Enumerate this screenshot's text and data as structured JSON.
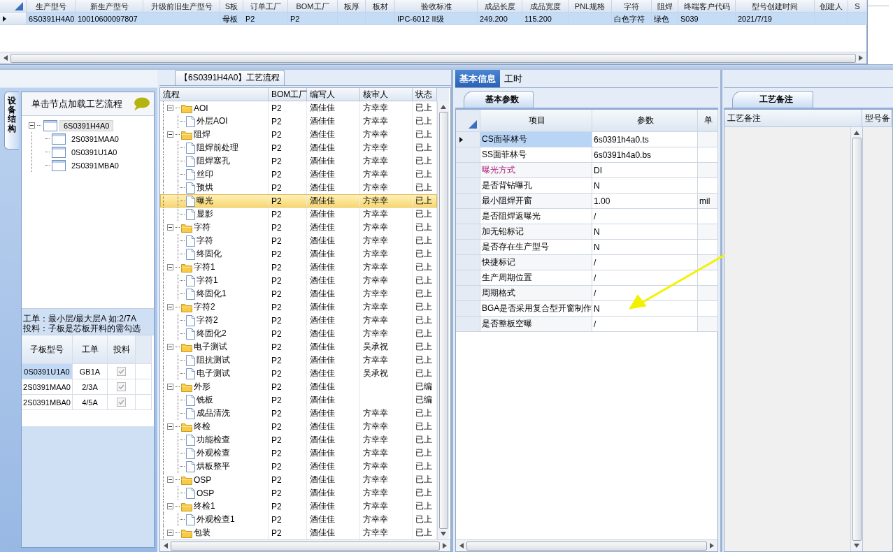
{
  "production_grid": {
    "columns": [
      "生产型号",
      "新生产型号",
      "升级前旧生产型号",
      "S板",
      "订单工厂",
      "BOM工厂",
      "板厚",
      "板材",
      "验收标准",
      "成品长度",
      "成品宽度",
      "PNL规格",
      "字符",
      "阻焊",
      "终端客户代码",
      "型号创建时间",
      "创建人",
      "S"
    ],
    "rows": [
      {
        "selected": true,
        "cells": [
          "6S0391H4A0",
          "10010600097807",
          null,
          "母板",
          "P2",
          "P2",
          null,
          null,
          "IPC-6012 II级",
          "249.200",
          "115.200",
          null,
          "白色字符",
          "绿色",
          "S039",
          "2021/7/19",
          null,
          null
        ]
      }
    ]
  },
  "equipment_panel": {
    "side_tab": "设备结构",
    "hint": "单击节点加载工艺流程",
    "tree": [
      {
        "label": "6S0391H4A0",
        "selected": true,
        "expanded": true,
        "children": [
          {
            "label": "2S0391MAA0",
            "selected": false
          },
          {
            "label": "0S0391U1A0",
            "selected": false
          },
          {
            "label": "2S0391MBA0",
            "selected": false
          }
        ]
      }
    ],
    "notes": [
      "工单：最小层/最大层A 如:2/7A",
      "投料：子板是芯板开料的需勾选"
    ],
    "sub_grid": {
      "columns": [
        "子板型号",
        "工单",
        "投料"
      ],
      "rows": [
        {
          "board": "0S0391U1A0",
          "order": "GB1A",
          "feed_checked": true,
          "selected": true
        },
        {
          "board": "2S0391MAA0",
          "order": "2/3A",
          "feed_checked": true,
          "selected": false
        },
        {
          "board": "2S0391MBA0",
          "order": "4/5A",
          "feed_checked": true,
          "selected": false
        }
      ]
    }
  },
  "process_flow": {
    "title": "【6S0391H4A0】工艺流程",
    "columns": [
      "流程",
      "BOM工厂",
      "编写人",
      "核审人",
      "状态"
    ],
    "steps": [
      {
        "label": "AOI",
        "bom": "P2",
        "author": "酒佳佳",
        "reviewer": "方幸幸",
        "status": "已上",
        "selected": false,
        "expanded": true,
        "children": [
          {
            "label": "外层AOI",
            "bom": "P2",
            "author": "酒佳佳",
            "reviewer": "方幸幸",
            "status": "已上",
            "selected": false
          }
        ]
      },
      {
        "label": "阻焊",
        "bom": "P2",
        "author": "酒佳佳",
        "reviewer": "方幸幸",
        "status": "已上",
        "selected": false,
        "expanded": true,
        "children": [
          {
            "label": "阻焊前处理",
            "bom": "P2",
            "author": "酒佳佳",
            "reviewer": "方幸幸",
            "status": "已上",
            "selected": false
          },
          {
            "label": "阻焊塞孔",
            "bom": "P2",
            "author": "酒佳佳",
            "reviewer": "方幸幸",
            "status": "已上",
            "selected": false
          },
          {
            "label": "丝印",
            "bom": "P2",
            "author": "酒佳佳",
            "reviewer": "方幸幸",
            "status": "已上",
            "selected": false
          },
          {
            "label": "预烘",
            "bom": "P2",
            "author": "酒佳佳",
            "reviewer": "方幸幸",
            "status": "已上",
            "selected": false
          },
          {
            "label": "曝光",
            "bom": "P2",
            "author": "酒佳佳",
            "reviewer": "方幸幸",
            "status": "已上",
            "selected": true
          },
          {
            "label": "显影",
            "bom": "P2",
            "author": "酒佳佳",
            "reviewer": "方幸幸",
            "status": "已上",
            "selected": false
          }
        ]
      },
      {
        "label": "字符",
        "bom": "P2",
        "author": "酒佳佳",
        "reviewer": "方幸幸",
        "status": "已上",
        "selected": false,
        "expanded": true,
        "children": [
          {
            "label": "字符",
            "bom": "P2",
            "author": "酒佳佳",
            "reviewer": "方幸幸",
            "status": "已上",
            "selected": false
          },
          {
            "label": "终固化",
            "bom": "P2",
            "author": "酒佳佳",
            "reviewer": "方幸幸",
            "status": "已上",
            "selected": false
          }
        ]
      },
      {
        "label": "字符1",
        "bom": "P2",
        "author": "酒佳佳",
        "reviewer": "方幸幸",
        "status": "已上",
        "selected": false,
        "expanded": true,
        "children": [
          {
            "label": "字符1",
            "bom": "P2",
            "author": "酒佳佳",
            "reviewer": "方幸幸",
            "status": "已上",
            "selected": false
          },
          {
            "label": "终固化1",
            "bom": "P2",
            "author": "酒佳佳",
            "reviewer": "方幸幸",
            "status": "已上",
            "selected": false
          }
        ]
      },
      {
        "label": "字符2",
        "bom": "P2",
        "author": "酒佳佳",
        "reviewer": "方幸幸",
        "status": "已上",
        "selected": false,
        "expanded": true,
        "children": [
          {
            "label": "字符2",
            "bom": "P2",
            "author": "酒佳佳",
            "reviewer": "方幸幸",
            "status": "已上",
            "selected": false
          },
          {
            "label": "终固化2",
            "bom": "P2",
            "author": "酒佳佳",
            "reviewer": "方幸幸",
            "status": "已上",
            "selected": false
          }
        ]
      },
      {
        "label": "电子测试",
        "bom": "P2",
        "author": "酒佳佳",
        "reviewer": "吴承祝",
        "status": "已上",
        "selected": false,
        "expanded": true,
        "children": [
          {
            "label": "阻抗测试",
            "bom": "P2",
            "author": "酒佳佳",
            "reviewer": "方幸幸",
            "status": "已上",
            "selected": false
          },
          {
            "label": "电子测试",
            "bom": "P2",
            "author": "酒佳佳",
            "reviewer": "吴承祝",
            "status": "已上",
            "selected": false
          }
        ]
      },
      {
        "label": "外形",
        "bom": "P2",
        "author": "酒佳佳",
        "status": "已编",
        "selected": false,
        "expanded": true,
        "children": [
          {
            "label": "铣板",
            "bom": "P2",
            "author": "酒佳佳",
            "status": "已编",
            "selected": false
          },
          {
            "label": "成品清洗",
            "bom": "P2",
            "author": "酒佳佳",
            "reviewer": "方幸幸",
            "status": "已上",
            "selected": false
          }
        ]
      },
      {
        "label": "终检",
        "bom": "P2",
        "author": "酒佳佳",
        "reviewer": "方幸幸",
        "status": "已上",
        "selected": false,
        "expanded": true,
        "children": [
          {
            "label": "功能检查",
            "bom": "P2",
            "author": "酒佳佳",
            "reviewer": "方幸幸",
            "status": "已上",
            "selected": false
          },
          {
            "label": "外观检查",
            "bom": "P2",
            "author": "酒佳佳",
            "reviewer": "方幸幸",
            "status": "已上",
            "selected": false
          },
          {
            "label": "烘板整平",
            "bom": "P2",
            "author": "酒佳佳",
            "reviewer": "方幸幸",
            "status": "已上",
            "selected": false
          }
        ]
      },
      {
        "label": "OSP",
        "bom": "P2",
        "author": "酒佳佳",
        "reviewer": "方幸幸",
        "status": "已上",
        "selected": false,
        "expanded": true,
        "children": [
          {
            "label": "OSP",
            "bom": "P2",
            "author": "酒佳佳",
            "reviewer": "方幸幸",
            "status": "已上",
            "selected": false
          }
        ]
      },
      {
        "label": "终检1",
        "bom": "P2",
        "author": "酒佳佳",
        "reviewer": "方幸幸",
        "status": "已上",
        "selected": false,
        "expanded": true,
        "children": [
          {
            "label": "外观检查1",
            "bom": "P2",
            "author": "酒佳佳",
            "reviewer": "方幸幸",
            "status": "已上",
            "selected": false
          }
        ]
      },
      {
        "label": "包装",
        "bom": "P2",
        "author": "酒佳佳",
        "reviewer": "方幸幸",
        "status": "已上",
        "selected": false,
        "expanded": true
      }
    ]
  },
  "info_panel": {
    "tabs": [
      {
        "label": "基本信息",
        "selected": true
      },
      {
        "label": "工时",
        "selected": false
      }
    ],
    "sub_tab": "基本参数",
    "columns": [
      "项目",
      "参数",
      "单"
    ],
    "rows": [
      {
        "item": "CS面菲林号",
        "value": "6s0391h4a0.ts",
        "selected": true,
        "emphasized": false
      },
      {
        "item": "SS面菲林号",
        "value": "6s0391h4a0.bs",
        "selected": false,
        "emphasized": false
      },
      {
        "item": "曝光方式",
        "value": "DI",
        "selected": false,
        "emphasized": true
      },
      {
        "item": "是否背钻曝孔",
        "value": "N",
        "selected": false,
        "emphasized": false
      },
      {
        "item": "最小阻焊开窗",
        "value": "1.00",
        "unit": "mil",
        "selected": false,
        "emphasized": false
      },
      {
        "item": "是否阻焊返曝光",
        "value": "/",
        "selected": false,
        "emphasized": false
      },
      {
        "item": "加无铅标记",
        "value": "N",
        "selected": false,
        "emphasized": false
      },
      {
        "item": "是否存在生产型号",
        "value": "N",
        "selected": false,
        "emphasized": false
      },
      {
        "item": "快捷标记",
        "value": "/",
        "selected": false,
        "emphasized": false
      },
      {
        "item": "生产周期位置",
        "value": "/",
        "selected": false,
        "emphasized": false
      },
      {
        "item": "周期格式",
        "value": "/",
        "selected": false,
        "emphasized": false
      },
      {
        "item": "BGA是否采用复合型开窗制作",
        "value": "N",
        "selected": false,
        "emphasized": false
      },
      {
        "item": "是否整板空曝",
        "value": "/",
        "selected": false,
        "emphasized": false
      }
    ]
  },
  "notes_panel": {
    "tab": "工艺备注",
    "columns": [
      "工艺备注",
      "型号备"
    ]
  }
}
